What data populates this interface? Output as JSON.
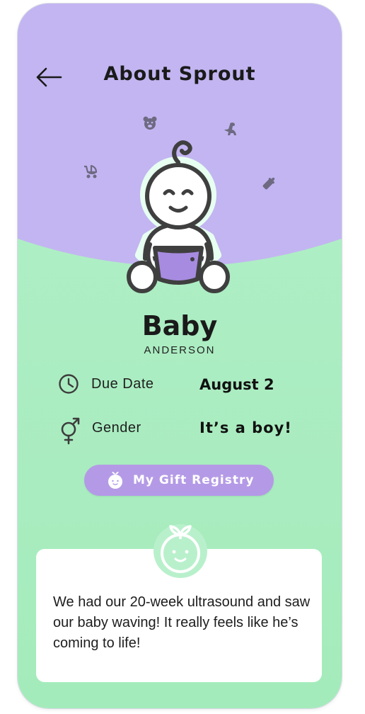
{
  "header": {
    "title": "About Sprout",
    "back_icon": "arrow-left-icon"
  },
  "baby": {
    "first_name": "Baby",
    "last_name": "ANDERSON"
  },
  "details": {
    "due_date": {
      "label": "Due Date",
      "value": "August 2",
      "icon": "clock-icon"
    },
    "gender": {
      "label": "Gender",
      "value": "It’s a boy!",
      "icon": "gender-icon"
    }
  },
  "registry": {
    "label": "My Gift Registry",
    "icon": "baby-face-icon"
  },
  "note": {
    "text": "We had our 20-week ultrasound and saw our baby waving! It really feels like he’s coming to life!"
  },
  "colors": {
    "header_purple": "#c3b5f1",
    "body_green": "#a9ecc0",
    "button_purple": "#b49ae6",
    "diaper_purple": "#a78be0"
  }
}
